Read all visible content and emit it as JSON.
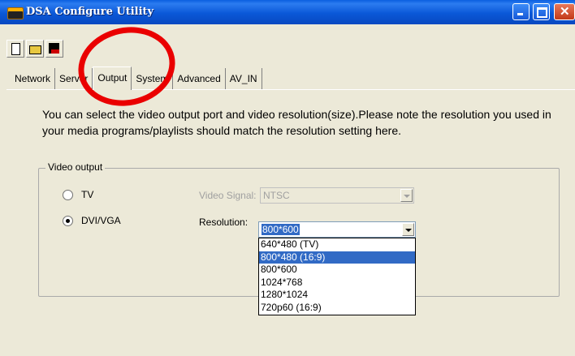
{
  "window": {
    "title": "DSA Configure Utility"
  },
  "toolbar": [
    "new-icon",
    "open-icon",
    "save-icon"
  ],
  "tabs": [
    {
      "label": "Network"
    },
    {
      "label": "Server"
    },
    {
      "label": "Output",
      "active": true
    },
    {
      "label": "System"
    },
    {
      "label": "Advanced"
    },
    {
      "label": "AV_IN"
    }
  ],
  "description": "You can select the video output port and video resolution(size).Please note the resolution you used in your media programs/playlists should match the resolution setting here.",
  "video_output": {
    "legend": "Video output",
    "tv_label": "TV",
    "dvi_label": "DVI/VGA",
    "signal_label": "Video Signal:",
    "signal_value": "NTSC",
    "resolution_label": "Resolution:",
    "resolution_value": "800*600",
    "resolution_options": [
      "640*480 (TV)",
      "800*480 (16:9)",
      "800*600",
      "1024*768",
      "1280*1024",
      "720p60 (16:9)"
    ],
    "highlighted_option": "800*480 (16:9)"
  },
  "colors": {
    "title_bar": "#0a5fe0",
    "selection": "#316ac5",
    "annotation": "#ea0000"
  }
}
